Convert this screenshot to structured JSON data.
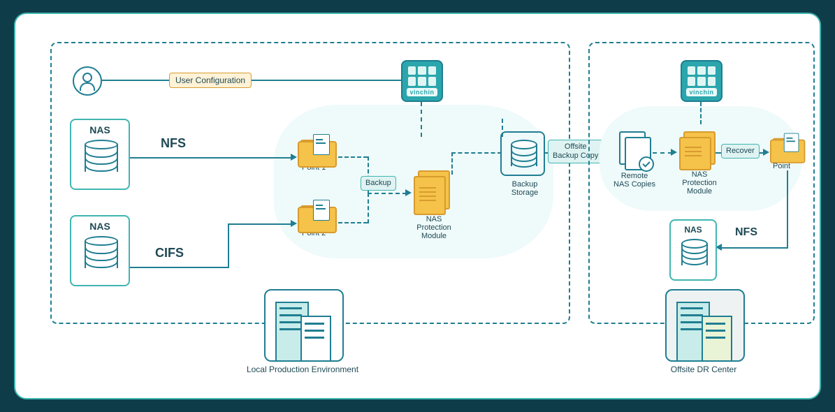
{
  "brand": "vinchin",
  "local": {
    "title": "Local Production Environment",
    "user_config": "User Configuration",
    "nas_label": "NAS",
    "proto_nfs": "NFS",
    "proto_cifs": "CIFS",
    "mount1": "Mount\nPoint 1",
    "mount2": "Mount\nPoint 2",
    "backup": "Backup",
    "protection_module": "NAS\nProtection\nModule",
    "backup_storage": "Backup\nStorage"
  },
  "link": {
    "offsite_copy": "Offsite\nBackup Copy"
  },
  "offsite": {
    "title": "Offsite DR Center",
    "remote_copies": "Remote\nNAS Copies",
    "protection_module": "NAS\nProtection\nModule",
    "recover": "Recover",
    "mount": "Mount\nPoint",
    "nas_label": "NAS",
    "proto_nfs": "NFS"
  }
}
